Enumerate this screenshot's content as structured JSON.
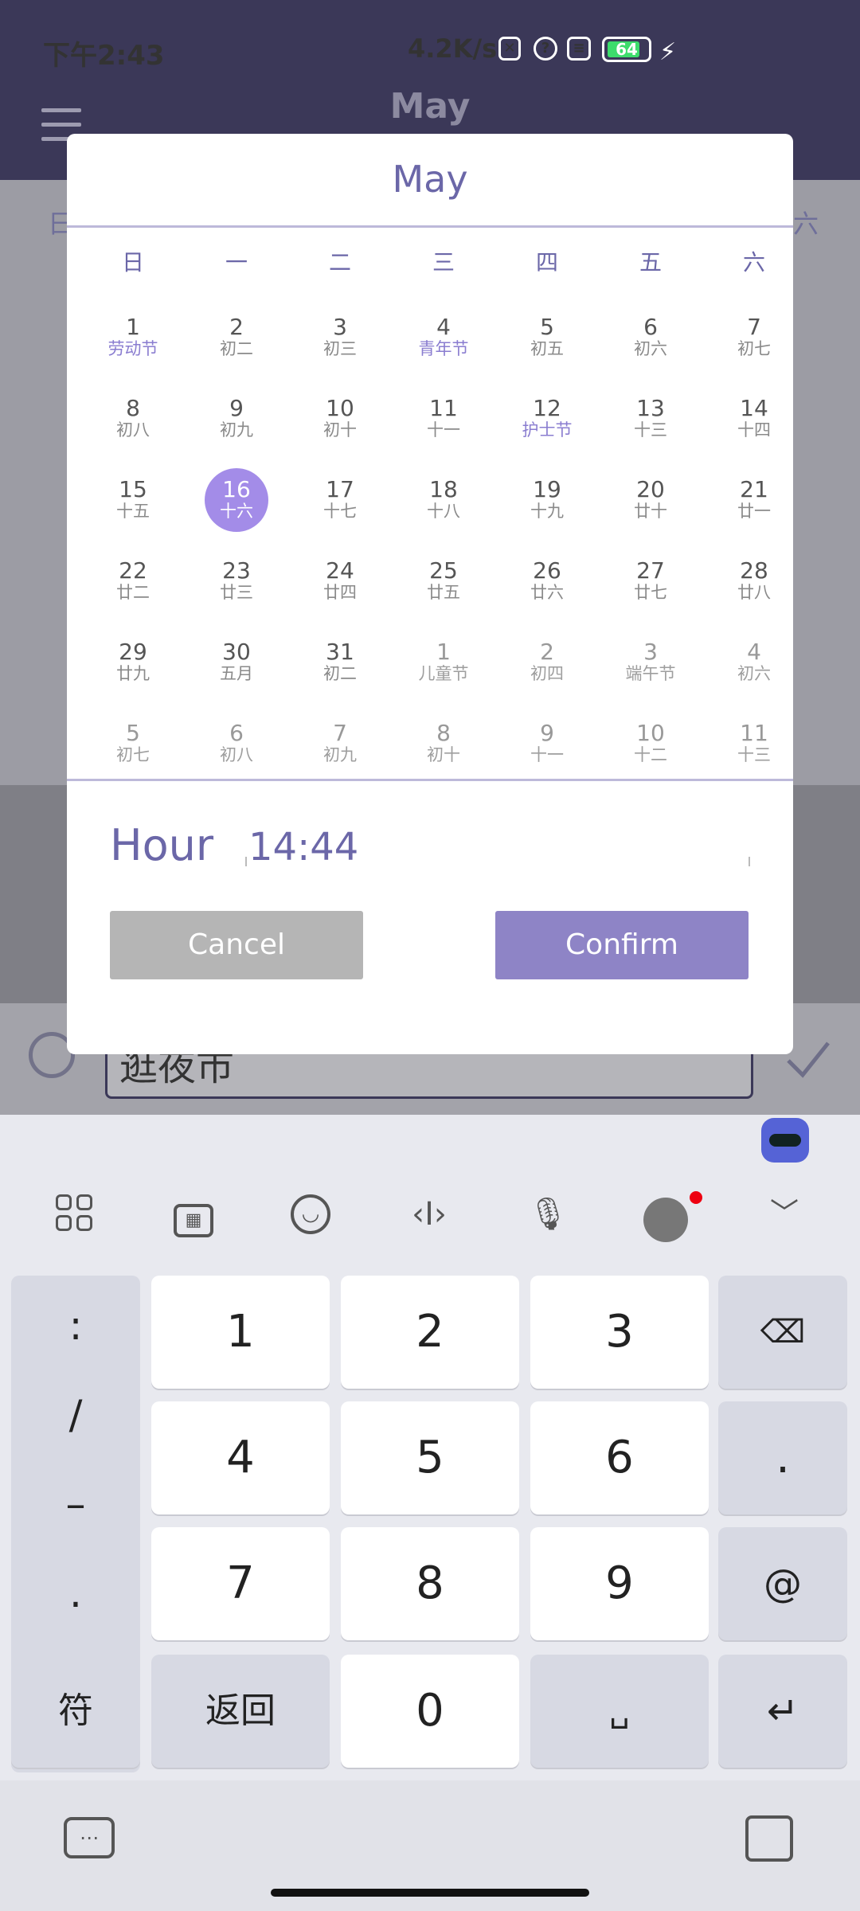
{
  "status_bar": {
    "time": "下午2:43",
    "speed": "4.2K/s",
    "battery": "64"
  },
  "app": {
    "title": "May"
  },
  "background": {
    "weekday_first": "日",
    "weekday_last": "六",
    "input_text": "逛夜市"
  },
  "dialog": {
    "month": "May",
    "weekdays": [
      "日",
      "一",
      "二",
      "三",
      "四",
      "五",
      "六"
    ],
    "rows": [
      [
        {
          "d": "1",
          "l": "劳动节",
          "t": "fest"
        },
        {
          "d": "2",
          "l": "初二"
        },
        {
          "d": "3",
          "l": "初三"
        },
        {
          "d": "4",
          "l": "青年节",
          "t": "fest"
        },
        {
          "d": "5",
          "l": "初五"
        },
        {
          "d": "6",
          "l": "初六"
        },
        {
          "d": "7",
          "l": "初七"
        }
      ],
      [
        {
          "d": "8",
          "l": "初八"
        },
        {
          "d": "9",
          "l": "初九"
        },
        {
          "d": "10",
          "l": "初十"
        },
        {
          "d": "11",
          "l": "十一"
        },
        {
          "d": "12",
          "l": "护士节",
          "t": "fest"
        },
        {
          "d": "13",
          "l": "十三"
        },
        {
          "d": "14",
          "l": "十四"
        }
      ],
      [
        {
          "d": "15",
          "l": "十五"
        },
        {
          "d": "16",
          "l": "十六",
          "t": "sel"
        },
        {
          "d": "17",
          "l": "十七"
        },
        {
          "d": "18",
          "l": "十八"
        },
        {
          "d": "19",
          "l": "十九"
        },
        {
          "d": "20",
          "l": "廿十"
        },
        {
          "d": "21",
          "l": "廿一"
        }
      ],
      [
        {
          "d": "22",
          "l": "廿二"
        },
        {
          "d": "23",
          "l": "廿三"
        },
        {
          "d": "24",
          "l": "廿四"
        },
        {
          "d": "25",
          "l": "廿五"
        },
        {
          "d": "26",
          "l": "廿六"
        },
        {
          "d": "27",
          "l": "廿七"
        },
        {
          "d": "28",
          "l": "廿八"
        }
      ],
      [
        {
          "d": "29",
          "l": "廿九"
        },
        {
          "d": "30",
          "l": "五月"
        },
        {
          "d": "31",
          "l": "初二"
        },
        {
          "d": "1",
          "l": "儿童节",
          "t": "other"
        },
        {
          "d": "2",
          "l": "初四",
          "t": "other"
        },
        {
          "d": "3",
          "l": "端午节",
          "t": "other"
        },
        {
          "d": "4",
          "l": "初六",
          "t": "other"
        }
      ],
      [
        {
          "d": "5",
          "l": "初七",
          "t": "other"
        },
        {
          "d": "6",
          "l": "初八",
          "t": "other"
        },
        {
          "d": "7",
          "l": "初九",
          "t": "other"
        },
        {
          "d": "8",
          "l": "初十",
          "t": "other"
        },
        {
          "d": "9",
          "l": "十一",
          "t": "other"
        },
        {
          "d": "10",
          "l": "十二",
          "t": "other"
        },
        {
          "d": "11",
          "l": "十三",
          "t": "other"
        }
      ]
    ],
    "hour_label": "Hour",
    "hour_value": "14:44",
    "cancel": "Cancel",
    "confirm": "Confirm"
  },
  "keyboard": {
    "symbols": [
      ":",
      "/",
      "–",
      "."
    ],
    "digits": [
      "1",
      "2",
      "3",
      "4",
      "5",
      "6",
      "7",
      "8",
      "9"
    ],
    "dot": ".",
    "at": "@",
    "fu": "符",
    "back": "返回",
    "zero": "0"
  }
}
